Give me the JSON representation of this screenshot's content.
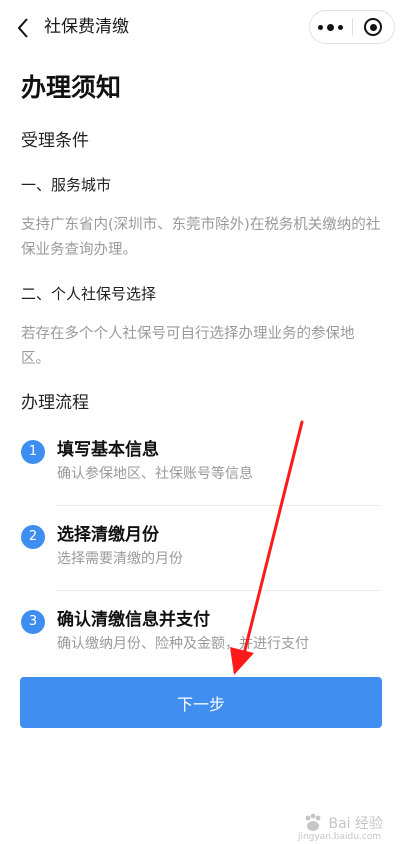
{
  "header": {
    "title": "社保费清缴"
  },
  "page_title": "办理须知",
  "conditions": {
    "title": "受理条件",
    "items": [
      {
        "heading": "一、服务城市",
        "text": "支持广东省内(深圳市、东莞市除外)在税务机关缴纳的社保业务查询办理。"
      },
      {
        "heading": "二、个人社保号选择",
        "text": "若存在多个个人社保号可自行选择办理业务的参保地区。"
      }
    ]
  },
  "process": {
    "title": "办理流程",
    "steps": [
      {
        "num": "1",
        "title": "填写基本信息",
        "desc": "确认参保地区、社保账号等信息"
      },
      {
        "num": "2",
        "title": "选择清缴月份",
        "desc": "选择需要清缴的月份"
      },
      {
        "num": "3",
        "title": "确认清缴信息并支付",
        "desc": "确认缴纳月份、险种及金额，并进行支付"
      }
    ]
  },
  "next_button": "下一步",
  "watermark": {
    "text": "Bai 经验",
    "url": "jingyan.baidu.com"
  },
  "colors": {
    "accent": "#3f8ef0",
    "arrow": "#ff1a1a"
  }
}
